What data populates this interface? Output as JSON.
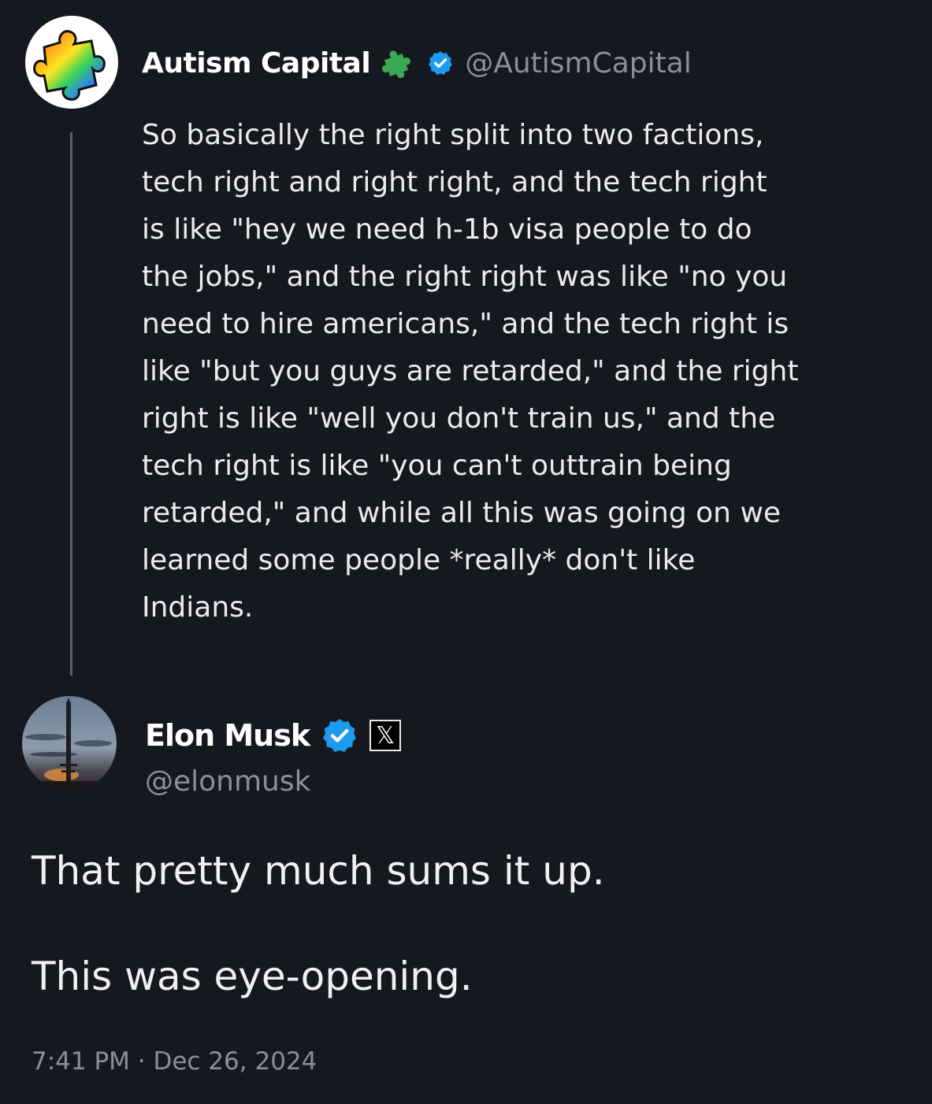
{
  "quoted_tweet": {
    "author_name": "Autism Capital",
    "author_handle": "@AutismCapital",
    "text": "So basically the right split into two factions,\ntech right and right right, and the tech right\nis like \"hey we need h-1b visa people to do\nthe jobs,\" and the right right was like \"no you\nneed to hire americans,\" and the tech right is\nlike \"but you guys are retarded,\" and the right\nright is like \"well you don't train us,\" and the\ntech right is like \"you can't outtrain being\nretarded,\" and while all this was going on we\nlearned some people *really* don't like\nIndians.",
    "icons": [
      "puzzle-piece-icon",
      "verified-badge-icon"
    ]
  },
  "main_tweet": {
    "author_name": "Elon Musk",
    "author_handle": "@elonmusk",
    "affiliate_badge": "𝕏",
    "paragraphs": [
      "That pretty much sums it up.",
      "This was eye-opening."
    ],
    "timestamp": "7:41 PM · Dec 26, 2024",
    "icons": [
      "verified-badge-icon",
      "x-affiliate-icon"
    ]
  },
  "colors": {
    "background": "#15181e",
    "verified_blue": "#1d9bf0",
    "secondary_text": "#8b9097",
    "puzzle_green": "#3aa856"
  }
}
